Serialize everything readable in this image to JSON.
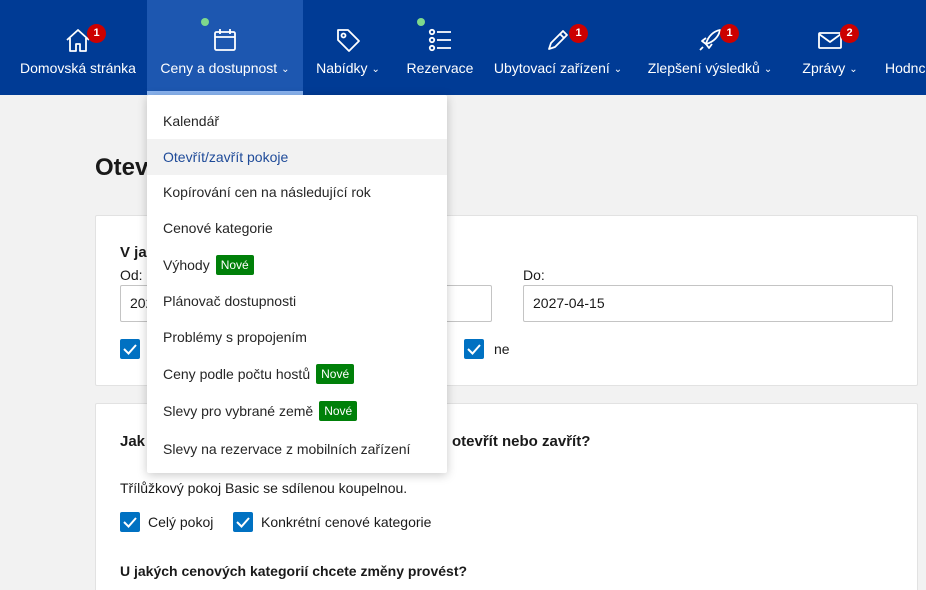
{
  "nav": {
    "items": [
      {
        "label": "Domovská stránka",
        "icon": "home-icon",
        "badge": "1",
        "has_dot": false,
        "has_chevron": false,
        "active": false
      },
      {
        "label": "Ceny a dostupnost",
        "icon": "calendar-icon",
        "badge": "",
        "has_dot": true,
        "has_chevron": true,
        "active": true
      },
      {
        "label": "Nabídky",
        "icon": "tag-icon",
        "badge": "",
        "has_dot": false,
        "has_chevron": true,
        "active": false
      },
      {
        "label": "Rezervace",
        "icon": "list-icon",
        "badge": "",
        "has_dot": true,
        "has_chevron": false,
        "active": false
      },
      {
        "label": "Ubytovací zařízení",
        "icon": "pencil-icon",
        "badge": "1",
        "has_dot": false,
        "has_chevron": true,
        "active": false
      },
      {
        "label": "Zlepšení výsledků",
        "icon": "rocket-icon",
        "badge": "1",
        "has_dot": false,
        "has_chevron": true,
        "active": false
      },
      {
        "label": "Zprávy",
        "icon": "envelope-icon",
        "badge": "2",
        "has_dot": false,
        "has_chevron": true,
        "active": false
      },
      {
        "label": "Hodnc",
        "icon": "",
        "badge": "",
        "has_dot": false,
        "has_chevron": false,
        "active": false
      }
    ],
    "chevron": "⌄"
  },
  "dropdown": {
    "items": [
      {
        "label": "Kalendář",
        "new": false,
        "hover": false
      },
      {
        "label": "Otevřít/zavřít pokoje",
        "new": false,
        "hover": true
      },
      {
        "label": "Kopírování cen na následující rok",
        "new": false,
        "hover": false
      },
      {
        "label": "Cenové kategorie",
        "new": false,
        "hover": false
      },
      {
        "label": "Výhody",
        "new": true,
        "hover": false
      },
      {
        "label": "Plánovač dostupnosti",
        "new": false,
        "hover": false
      },
      {
        "label": "Problémy s propojením",
        "new": false,
        "hover": false
      },
      {
        "label": "Ceny podle počtu hostů",
        "new": true,
        "hover": false
      },
      {
        "label": "Slevy pro vybrané země",
        "new": true,
        "hover": false
      },
      {
        "label": "Slevy na rezervace z mobilních zařízení",
        "new": false,
        "hover": false
      }
    ],
    "new_badge_label": "Nové"
  },
  "page": {
    "title_visible": "Otev"
  },
  "section1": {
    "question_visible": "V ja",
    "from_label_visible": "Od:",
    "from_value_visible": "202",
    "to_label": "Do:",
    "to_value": "2027-04-15",
    "weekday_label_visible": "ne"
  },
  "section2": {
    "question_left_visible": "Jak",
    "question_right_visible": "otevřít nebo zavřít?",
    "room_text": "Třílůžkový pokoj Basic se sdílenou koupelnou.",
    "opt_whole_room": "Celý pokoj",
    "opt_specific_rates": "Konkrétní cenové kategorie",
    "rates_question": "U jakých cenových kategorií chcete změny provést?"
  },
  "colors": {
    "nav_bg": "#003b95",
    "nav_active": "#1d57b0",
    "checkbox": "#0071c2",
    "badge_red": "#cc0000",
    "new_green": "#008009",
    "dot_green": "#7ed98c"
  }
}
